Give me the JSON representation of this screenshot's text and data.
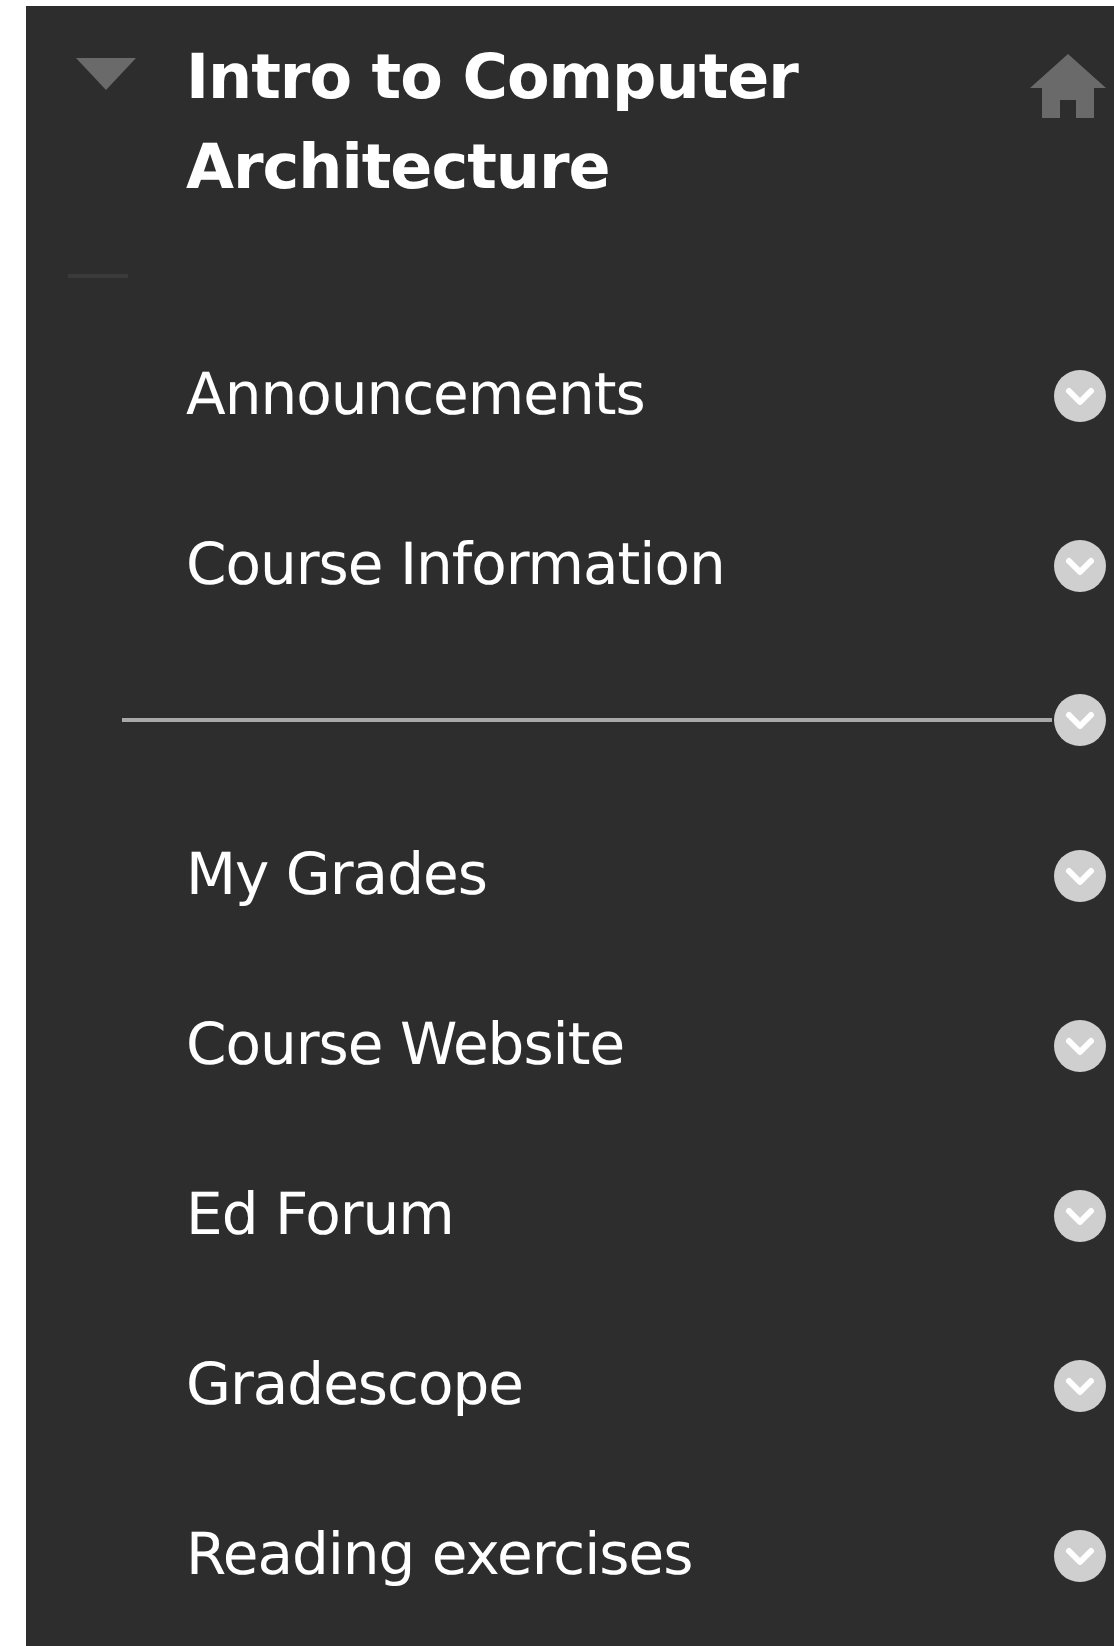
{
  "course": {
    "title": "Intro to Computer Architecture",
    "expanded": true
  },
  "menu": [
    {
      "kind": "link",
      "label": "Announcements"
    },
    {
      "kind": "link",
      "label": "Course Information"
    },
    {
      "kind": "divider"
    },
    {
      "kind": "link",
      "label": "My Grades"
    },
    {
      "kind": "link",
      "label": "Course Website"
    },
    {
      "kind": "link",
      "label": "Ed Forum"
    },
    {
      "kind": "link",
      "label": "Gradescope"
    },
    {
      "kind": "link",
      "label": "Reading exercises"
    }
  ]
}
